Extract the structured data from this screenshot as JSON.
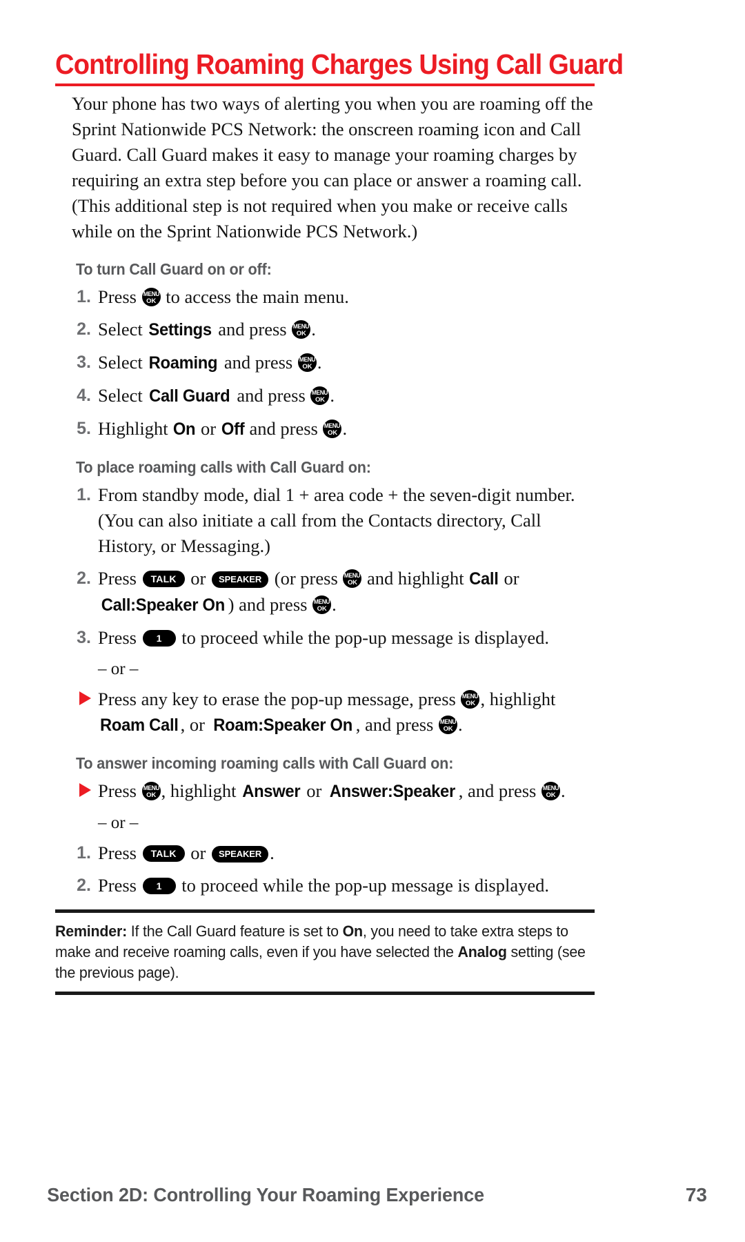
{
  "colors": {
    "title_red": "#EC1C24",
    "subhead_gray": "#58595B",
    "marker_gray": "#6D6E71",
    "body_black": "#151515",
    "rule_black": "#1A1A1A"
  },
  "title": "Controlling Roaming Charges Using Call Guard",
  "intro": "Your phone has two ways of alerting you when you are roaming off the Sprint Nationwide PCS Network: the onscreen roaming icon and Call Guard. Call Guard makes it easy to manage your roaming charges by requiring an extra step before you can place or answer a roaming call. (This additional step is not required when you make or receive calls while on the Sprint Nationwide PCS Network.)",
  "keys": {
    "menu": "MENU",
    "ok": "OK",
    "talk": "TALK",
    "speaker": "SPEAKER",
    "one": "1"
  },
  "sections": [
    {
      "heading": "To turn Call Guard on or off:",
      "steps": [
        {
          "marker": "1.",
          "text_before": "Press ",
          "text_after": " to access the main menu."
        },
        {
          "marker": "2.",
          "text_before": "Select ",
          "emph": "Settings",
          "text_mid": " and press ",
          "text_after": "."
        },
        {
          "marker": "3.",
          "text_before": "Select ",
          "emph": "Roaming",
          "text_mid": " and press ",
          "text_after": "."
        },
        {
          "marker": "4.",
          "text_before": "Select ",
          "emph": "Call Guard",
          "text_mid": " and press ",
          "text_after": "."
        },
        {
          "marker": "5.",
          "text_before": "Highlight ",
          "emph": "On",
          "text_mid": " or ",
          "emph2": "Off",
          "text_mid2": " and press ",
          "text_after": "."
        }
      ]
    },
    {
      "heading": "To place roaming calls with Call Guard on:",
      "steps": [
        {
          "marker": "1.",
          "text": "From standby mode, dial 1 + area code + the seven-digit number. (You can also initiate a call from the Contacts directory, Call History, or Messaging.)"
        },
        {
          "marker": "2.",
          "p1": "Press ",
          "p2": " or ",
          "p3": " (or press ",
          "p4": " and highlight ",
          "emph": "Call",
          "p5": " or ",
          "emph2": "Call:Speaker On",
          "p6": ") and press ",
          "p7": "."
        },
        {
          "marker": "3.",
          "p1": "Press ",
          "p2": " to proceed while the pop-up message is displayed."
        }
      ],
      "or_label": "– or –",
      "after_or": {
        "marker": "arrow",
        "p1": "Press any key to erase the pop-up message, press ",
        "p2": ", highlight ",
        "emph": "Roam Call",
        "p3": ", or ",
        "emph2": "Roam:Speaker On",
        "p4": ", and press ",
        "p5": "."
      }
    },
    {
      "heading": "To answer incoming roaming calls with Call Guard on:",
      "arrow_step": {
        "p1": "Press ",
        "p2": ", highlight ",
        "emph": "Answer",
        "p3": " or ",
        "emph2": "Answer:Speaker",
        "p4": ", and press ",
        "p5": "."
      },
      "or_label": "– or –",
      "steps": [
        {
          "marker": "1.",
          "p1": "Press ",
          "p2": " or ",
          "p3": "."
        },
        {
          "marker": "2.",
          "p1": "Press ",
          "p2": " to proceed while the pop-up message is displayed."
        }
      ]
    }
  ],
  "reminder": {
    "label": "Reminder:",
    "part1": " If the Call Guard feature is set to ",
    "emph1": "On",
    "part2": ", you need to take extra steps to make and receive roaming calls, even if you have selected the ",
    "emph2": "Analog",
    "part3": " setting (see the previous page)."
  },
  "footer": {
    "section": "Section 2D: Controlling Your Roaming Experience",
    "page": "73"
  }
}
